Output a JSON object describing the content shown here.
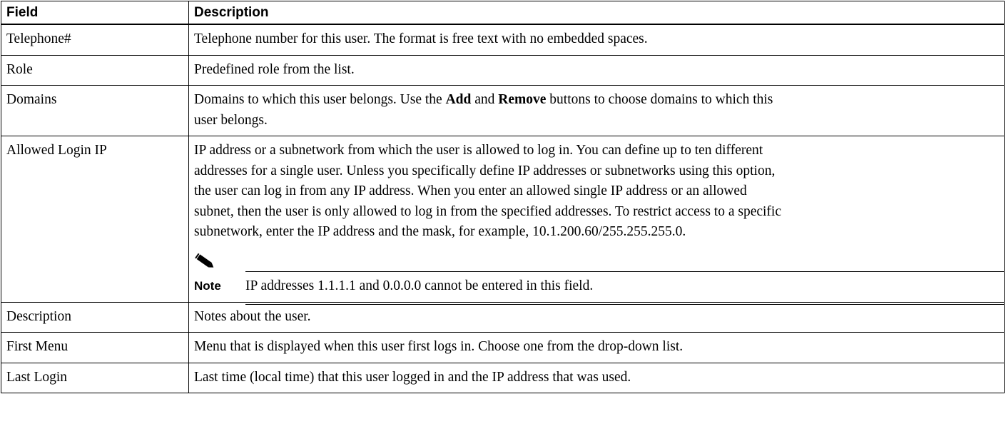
{
  "table": {
    "headers": {
      "field": "Field",
      "description": "Description"
    },
    "rows": [
      {
        "field": "Telephone#",
        "description": "Telephone number for this user. The format is free text with no embedded spaces."
      },
      {
        "field": "Role",
        "description": "Predefined role from the list."
      },
      {
        "field": "Domains",
        "description_parts": {
          "before_add": "Domains to which this user belongs. Use the ",
          "add": "Add",
          "between": " and ",
          "remove": "Remove",
          "after_remove": " buttons to choose domains to which this",
          "line2": "user belongs."
        }
      },
      {
        "field": "Allowed Login IP",
        "description_lines": [
          "IP address or a subnetwork from which the user is allowed to log in. You can define up to ten different",
          "addresses for a single user. Unless you specifically define IP addresses or subnetworks using this option,",
          "the user can log in from any IP address. When you enter an allowed single IP address or an allowed",
          "subnet, then the user is only allowed to log in from the specified addresses. To restrict access to a specific",
          "subnetwork, enter the IP address and the mask, for example, 10.1.200.60/255.255.255.0."
        ],
        "note": {
          "icon": "pencil-icon",
          "label": "Note",
          "text": "IP addresses 1.1.1.1 and 0.0.0.0 cannot be entered in this field."
        }
      },
      {
        "field": "Description",
        "description": "Notes about the user."
      },
      {
        "field": "First Menu",
        "description": "Menu that is displayed when this user first logs in. Choose one from the drop-down list."
      },
      {
        "field": "Last Login",
        "description": "Last time (local time) that this user logged in and the IP address that was used."
      }
    ]
  }
}
